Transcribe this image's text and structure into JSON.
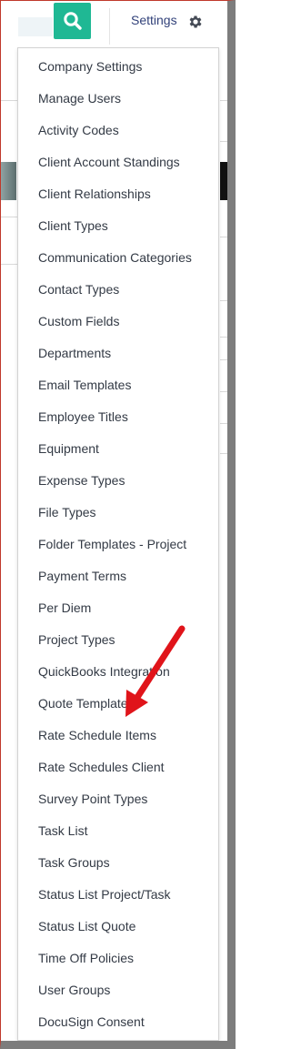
{
  "header": {
    "settings_label": "Settings"
  },
  "menu": {
    "items": [
      "Company Settings",
      "Manage Users",
      "Activity Codes",
      "Client Account Standings",
      "Client Relationships",
      "Client Types",
      "Communication Categories",
      "Contact Types",
      "Custom Fields",
      "Departments",
      "Email Templates",
      "Employee Titles",
      "Equipment",
      "Expense Types",
      "File Types",
      "Folder Templates - Project",
      "Payment Terms",
      "Per Diem",
      "Project Types",
      "QuickBooks Integration",
      "Quote Templates",
      "Rate Schedule Items",
      "Rate Schedules Client",
      "Survey Point Types",
      "Task List",
      "Task Groups",
      "Status List Project/Task",
      "Status List Quote",
      "Time Off Policies",
      "User Groups",
      "DocuSign Consent"
    ]
  },
  "colors": {
    "search_button": "#1fb894",
    "settings_text": "#32427a",
    "menu_text": "#333a45",
    "annotation_arrow": "#e0141a"
  },
  "icons": {
    "search": "search-icon",
    "gear": "gear-icon",
    "annotation": "red-arrow-annotation"
  }
}
